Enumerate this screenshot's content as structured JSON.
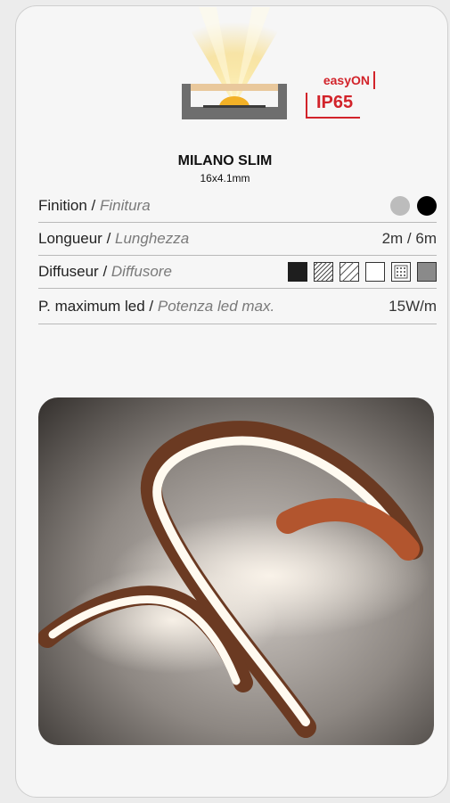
{
  "badge": {
    "line1": "easyON",
    "line2": "IP65"
  },
  "product": {
    "name": "MILANO SLIM",
    "dimensions": "16x4.1mm"
  },
  "specs": {
    "finish": {
      "label_fr": "Finition",
      "sep": " / ",
      "label_it": "Finitura",
      "swatches": [
        "#bcbcbc",
        "#000000"
      ]
    },
    "length": {
      "label_fr": "Longueur",
      "sep": " / ",
      "label_it": "Lunghezza",
      "value": "2m / 6m"
    },
    "diffuser": {
      "label_fr": "Diffuseur",
      "sep": " / ",
      "label_it": "Diffusore",
      "swatches": [
        "black-opaque",
        "striped-dense",
        "striped-sparse",
        "clear",
        "dotted",
        "grey-opaque"
      ]
    },
    "power": {
      "label_fr": "P. maximum led",
      "sep": " / ",
      "label_it": "Potenza led max.",
      "value": "15W/m"
    }
  },
  "colors": {
    "accent": "#d2232a",
    "profile_body": "#6e6e6e",
    "led_glow": "#f7c448"
  }
}
